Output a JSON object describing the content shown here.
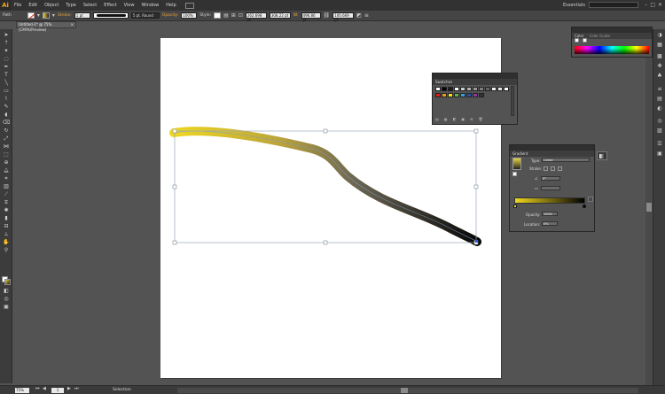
{
  "app": {
    "logo": "Ai",
    "menus": [
      "File",
      "Edit",
      "Object",
      "Type",
      "Select",
      "Effect",
      "View",
      "Window",
      "Help"
    ],
    "workspace": "Essentials",
    "window_controls": [
      "–",
      "□",
      "✕"
    ]
  },
  "control_bar": {
    "selection_label": "Path",
    "stroke_label": "Stroke:",
    "stroke_weight": "1 pt",
    "brush_name": "5 pt. Round",
    "opacity_label": "Opacity:",
    "opacity_value": "100%",
    "style_label": "Style:",
    "x_value": "262.698 pt",
    "y_value": "308.22 pt",
    "w_label": "W:",
    "w_value": "496.86 pt",
    "h_value": "100.669 pt"
  },
  "document": {
    "tab_title": "Untitled-1* @ 75% (CMYK/Preview)",
    "close": "×"
  },
  "status": {
    "zoom": "75%",
    "page": "1",
    "tool": "Selection"
  },
  "panels": {
    "swatches": {
      "tabs": [
        "Swatches"
      ],
      "colors": [
        "#ffffff",
        "#000000",
        "#1b1b1b",
        "#ffffff",
        "#cccccc",
        "#b3b3b3",
        "#999999",
        "#808080",
        "#666666",
        "#f0f0f0",
        "#e5e5e5",
        "#ffffff",
        "#e41b1b",
        "#f29c1c",
        "#f7e418",
        "#5ab947",
        "#35a0d9",
        "#2e52a3",
        "#8a3b9b",
        "#333333"
      ]
    },
    "color": {
      "tabs": [
        "Color",
        "Color Guide"
      ]
    },
    "gradient": {
      "tabs": [
        "Gradient"
      ],
      "type_label": "Type:",
      "type_value": "Linear",
      "stroke_label": "Stroke:",
      "angle_value": "0°",
      "aspect_value": "",
      "opacity_label": "Opacity:",
      "opacity_value": "100%",
      "location_label": "Location:",
      "location_value": "0%",
      "start_color": "#f0d81f",
      "end_color": "#000000"
    }
  },
  "accent": {
    "menubar_bg": "#323232",
    "ui_bg": "#535353",
    "selection_blue": "#7a9cc8",
    "stroke_start": "#f0d81f",
    "stroke_end": "#050505"
  }
}
